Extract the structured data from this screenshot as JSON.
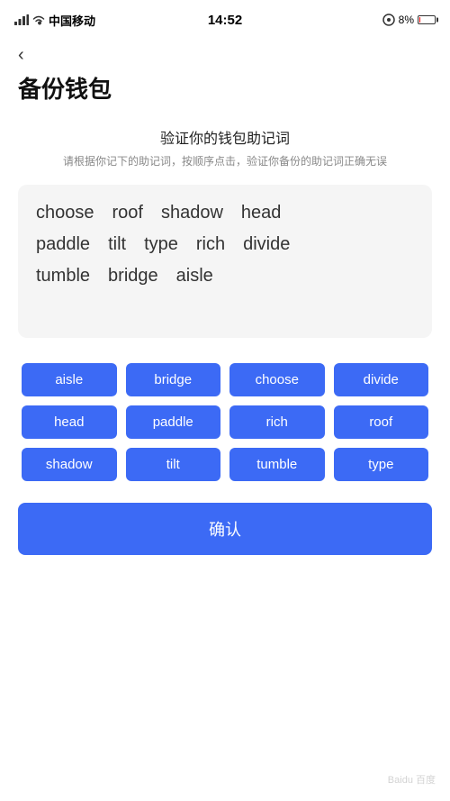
{
  "statusBar": {
    "carrier": "中国移动",
    "time": "14:52",
    "battery": "8%"
  },
  "backButton": {
    "label": "‹"
  },
  "pageTitle": "备份钱包",
  "sectionTitle": "验证你的钱包助记词",
  "sectionDesc": "请根据你记下的助记词，按顺序点击，验证你备份的助记词正确无误",
  "wordRows": [
    [
      "choose",
      "roof",
      "shadow",
      "head"
    ],
    [
      "paddle",
      "tilt",
      "type",
      "rich",
      "divide"
    ],
    [
      "tumble",
      "bridge",
      "aisle"
    ]
  ],
  "keywords": [
    "aisle",
    "bridge",
    "choose",
    "divide",
    "head",
    "paddle",
    "rich",
    "roof",
    "shadow",
    "tilt",
    "tumble",
    "type"
  ],
  "confirmButton": "确认"
}
